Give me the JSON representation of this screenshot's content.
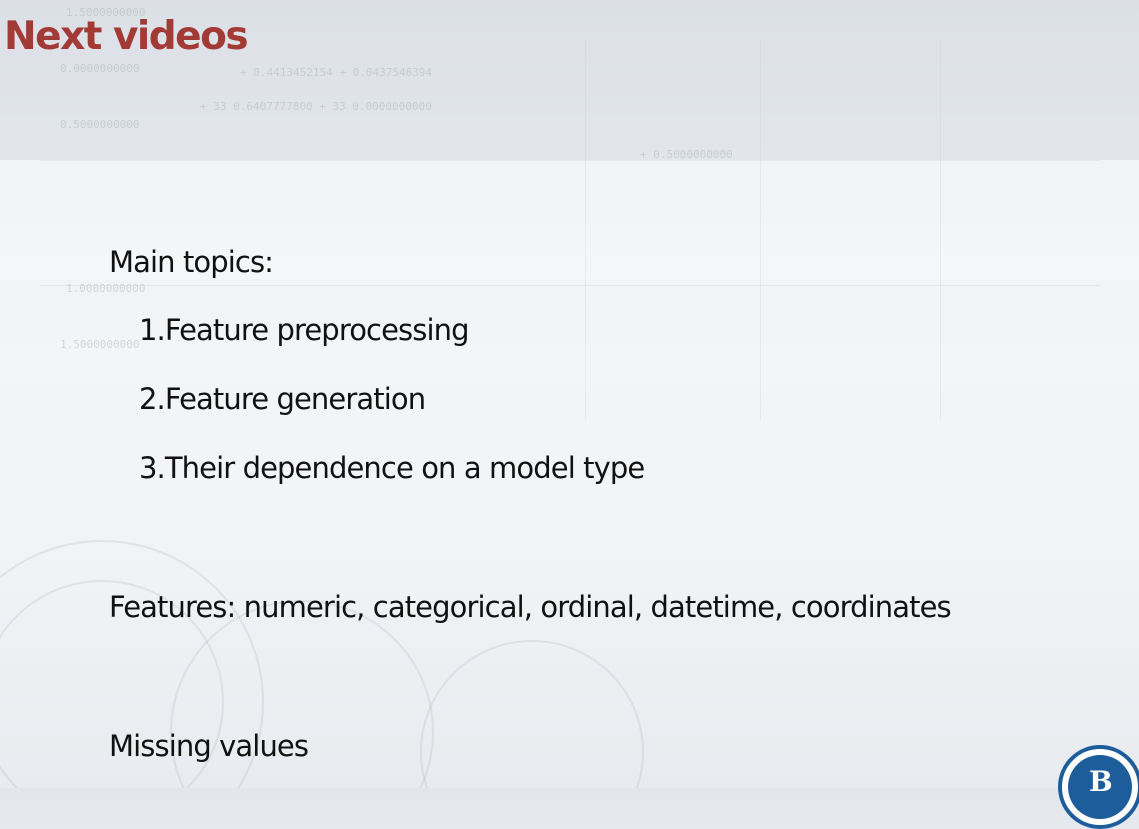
{
  "slide": {
    "title": "Next videos",
    "main_topics_heading": "Main topics:",
    "topics": [
      "1.Feature preprocessing",
      "2.Feature generation",
      "3.Their dependence on a model type"
    ],
    "features_line": "Features: numeric, categorical, ordinal, datetime, coordinates",
    "missing_values_line": "Missing values"
  },
  "colors": {
    "title": "#a23b35",
    "body_text": "#111111",
    "logo_blue": "#1e5d9c"
  },
  "logo": {
    "icon": "course-logo-icon",
    "letter": "B"
  }
}
